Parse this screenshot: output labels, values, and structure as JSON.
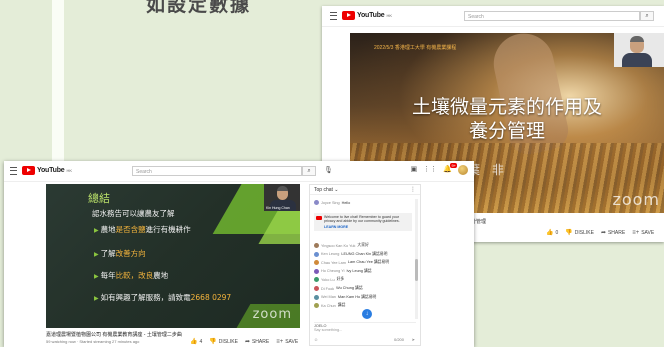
{
  "headline": "如設定數據",
  "back_window": {
    "logo": {
      "word": "YouTube",
      "sup": "HK"
    },
    "search_placeholder": "Search",
    "video": {
      "top_line": "2022/5/3 香港理工大學 有機農業課程",
      "title_line1": "土壤微量元素的作用及",
      "title_line2": "養分管理",
      "speaker": "葉 非",
      "zoom": "zoom"
    },
    "caption": "養分管理",
    "actions": {
      "like": "0",
      "dislike": "DISLIKE",
      "share": "SHARE",
      "save": "SAVE"
    }
  },
  "front_window": {
    "logo": {
      "word": "YouTube",
      "sup": "HK"
    },
    "search_placeholder": "Search",
    "notif_badge": "9+",
    "slide": {
      "title": "總結",
      "intro": "認水務告可以讓農友了解",
      "bullets": [
        {
          "pre": "農地",
          "hl": "是否含鹽",
          "post": "進行有機耕作"
        },
        {
          "pre": "了解",
          "hl": "改善方向",
          "post": ""
        },
        {
          "pre": "每年",
          "hl": "比較，改良",
          "post": "農地"
        },
        {
          "pre": "如有興趣了解服務，請致電",
          "hl": "2668 0297",
          "post": ""
        }
      ],
      "cam_name": "Kin Hung Chan",
      "zoom": "zoom"
    },
    "caption": "嘉道理農場暨植物園公司 有機農業教育講座 - 土壤管理二步曲",
    "meta": "59 watching now · Started streaming 27 minutes ago",
    "actions": {
      "like": "4",
      "dislike": "DISLIKE",
      "share": "SHARE",
      "save": "SAVE"
    },
    "chat": {
      "header": "Top chat ⌄",
      "first": {
        "name": "Joyce Sing",
        "msg": "Hello"
      },
      "welcome_text": "Welcome to live chat! Remember to guard your privacy and abide by our community guidelines.",
      "learn_more": "LEARN MORE",
      "messages": [
        {
          "name": "Yingsoo Kan Ko Yuk",
          "msg": "大家好",
          "color": "#9e7a5a"
        },
        {
          "name": "Ken Leung",
          "msg": "LEUNG Chan Kin 講話易明",
          "color": "#6a8fd0"
        },
        {
          "name": "Chau Yee Lam",
          "msg": "Lam Chau Yee 講話易明",
          "color": "#d08a3a"
        },
        {
          "name": "Ho Cheung Yi",
          "msg": "Ivy Leung 講話",
          "color": "#7c5ab8"
        },
        {
          "name": "Yoko Lu",
          "msg": "好多",
          "color": "#3a9a6a"
        },
        {
          "name": "Di Fook",
          "msg": "Wu Chung 講話",
          "color": "#c9545a"
        },
        {
          "name": "Wei Man",
          "msg": "Man Kam Ho 講話易明",
          "color": "#5a8fa0"
        },
        {
          "name": "Ka Chun",
          "msg": "講話",
          "color": "#a0a050"
        }
      ],
      "input_user": "JOELO",
      "input_placeholder": "Say something...",
      "counter": "0/200"
    }
  }
}
